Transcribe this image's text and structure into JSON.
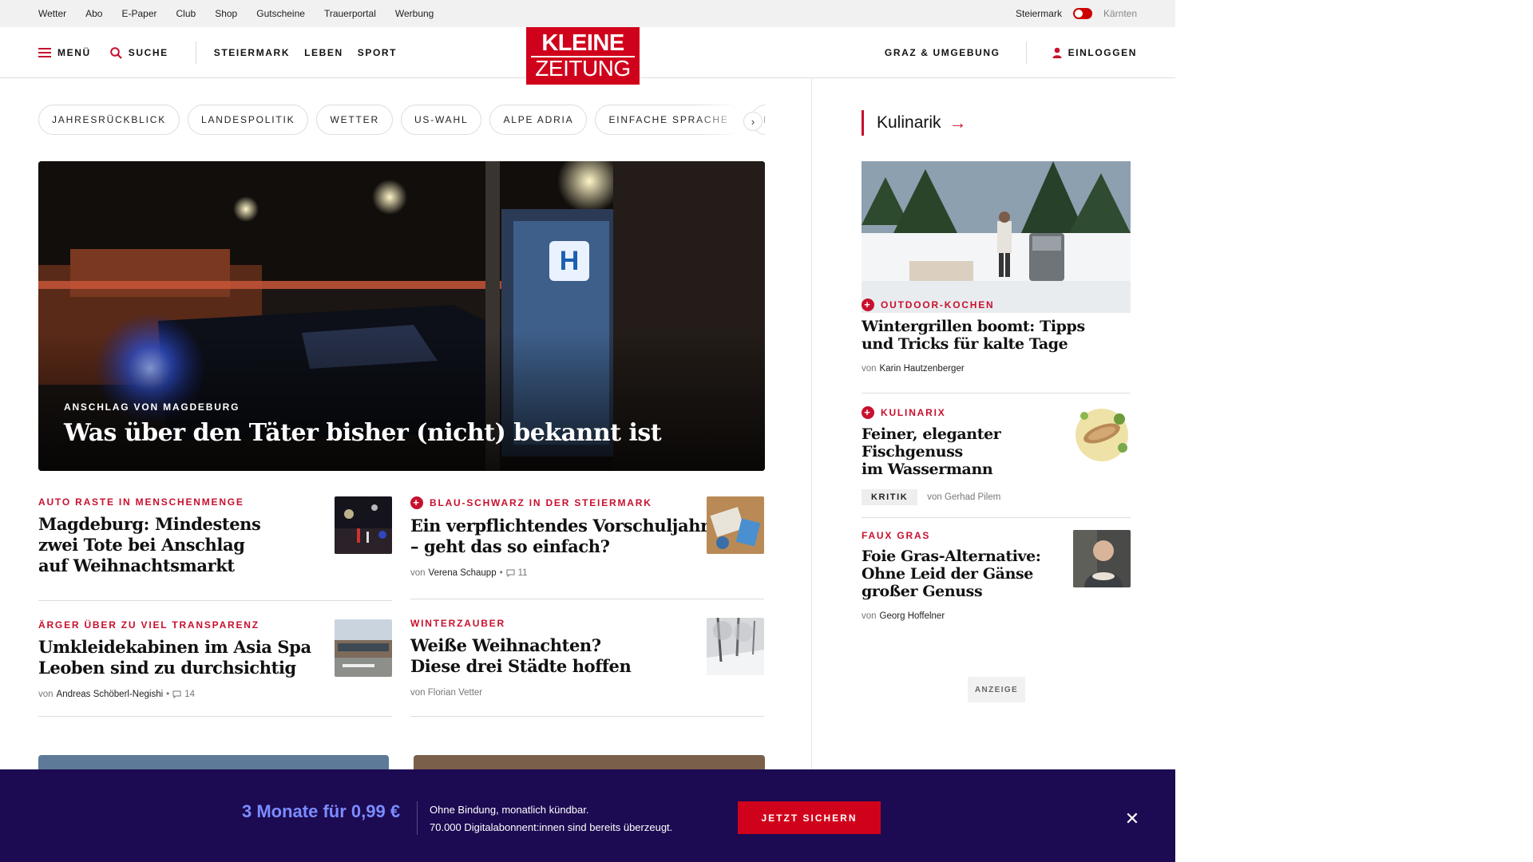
{
  "util_bar": {
    "links": [
      "Wetter",
      "Abo",
      "E-Paper",
      "Club",
      "Shop",
      "Gutscheine",
      "Trauerportal",
      "Werbung"
    ],
    "region_left": "Steiermark",
    "region_right": "Kärnten"
  },
  "header": {
    "menu_label": "MENÜ",
    "search_label": "SUCHE",
    "nav": [
      "STEIERMARK",
      "LEBEN",
      "SPORT"
    ],
    "logo_line1": "KLEINE",
    "logo_line2": "ZEITUNG",
    "region_link": "GRAZ & UMGEBUNG",
    "login_label": "EINLOGGEN"
  },
  "tags": [
    "JAHRESRÜCKBLICK",
    "LANDESPOLITIK",
    "WETTER",
    "US-WAHL",
    "ALPE ADRIA",
    "EINFACHE SPRACHE",
    "DO"
  ],
  "hero": {
    "kicker": "ANSCHLAG VON MAGDEBURG",
    "title": "Was über den Täter bisher (nicht) bekannt ist"
  },
  "articles": [
    {
      "kicker": "AUTO RASTE IN MENSCHENMENGE",
      "title_lines": [
        "Magdeburg: Mindestens",
        "zwei Tote bei Anschlag",
        "auf Weihnachtsmarkt"
      ]
    },
    {
      "kicker": "BLAU-SCHWARZ IN DER STEIERMARK",
      "title_lines": [
        "Ein verpflichtendes Vorschuljahr",
        "– geht das so einfach?"
      ],
      "by": "von",
      "author": "Verena Schaupp",
      "comments": "11"
    },
    {
      "kicker": "ÄRGER ÜBER ZU VIEL TRANSPARENZ",
      "title_lines": [
        "Umkleidekabinen im Asia Spa",
        "Leoben sind zu durchsichtig"
      ],
      "by": "von",
      "author": "Andreas Schöberl-Negishi",
      "comments": "14"
    },
    {
      "kicker": "WINTERZAUBER",
      "title_lines": [
        "Weiße Weihnachten?",
        "Diese drei Städte hoffen"
      ],
      "byline": "von Florian Vetter"
    }
  ],
  "rail": {
    "heading": "Kulinarik",
    "items": [
      {
        "kicker": "OUTDOOR-KOCHEN",
        "title_lines": [
          "Wintergrillen boomt: Tipps",
          "und Tricks für kalte Tage"
        ],
        "by": "von",
        "author": "Karin Hautzenberger"
      },
      {
        "kicker": "KULINARIX",
        "title_lines": [
          "Feiner, eleganter",
          "Fischgenuss",
          "im Wassermann"
        ],
        "badge": "KRITIK",
        "byline": "von Gerhad Pilem"
      },
      {
        "kicker": "FAUX GRAS",
        "title_lines": [
          "Foie Gras-Alternative:",
          "Ohne Leid der Gänse",
          "großer Genuss"
        ],
        "by": "von",
        "author": "Georg Hoffelner"
      }
    ],
    "ad_label": "ANZEIGE"
  },
  "promo": {
    "price": "3 Monate für 0,99 €",
    "line1": "Ohne Bindung, monatlich kündbar.",
    "line2": "70.000 Digitalabonnent:innen sind bereits überzeugt.",
    "cta": "JETZT SICHERN"
  },
  "colors": {
    "brand_red": "#d0021b",
    "kicker_red": "#c8102e",
    "promo_bg": "#1c0a52",
    "promo_price": "#7b8cff"
  }
}
